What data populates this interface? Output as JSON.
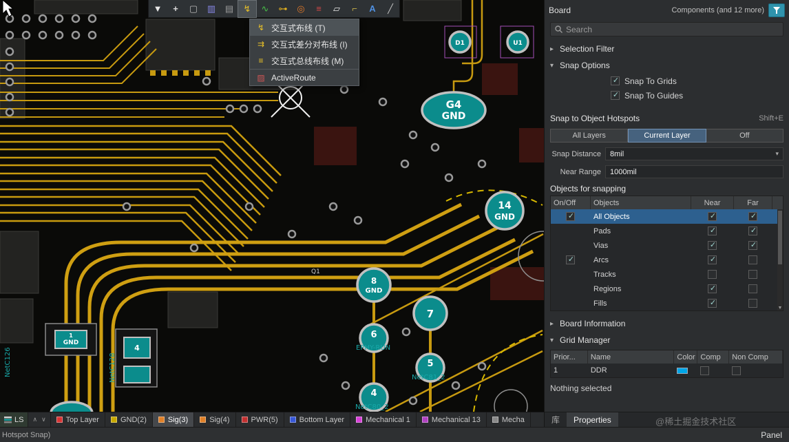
{
  "colors": {
    "selection_blue": "#2d608f",
    "pad_teal": "#0b8c8c",
    "trace_gold": "#c79a10",
    "filter_button_teal": "#2f93ac"
  },
  "toolbar": {
    "icons": [
      {
        "name": "filter-toolbar-icon",
        "glyph": "▼"
      },
      {
        "name": "move-icon",
        "glyph": "+"
      },
      {
        "name": "marquee-select-icon",
        "glyph": "▢"
      },
      {
        "name": "column-graph-icon",
        "glyph": "▥"
      },
      {
        "name": "row-graph-icon",
        "glyph": "▤"
      },
      {
        "name": "interactive-routing-icon",
        "glyph": "↯",
        "active": true
      },
      {
        "name": "signal-integrity-icon",
        "glyph": "∿"
      },
      {
        "name": "key-icon",
        "glyph": "⊶"
      },
      {
        "name": "via-stitch-icon",
        "glyph": "◎"
      },
      {
        "name": "layer-stack-icon",
        "glyph": "≡"
      },
      {
        "name": "polygon-pour-icon",
        "glyph": "▱"
      },
      {
        "name": "measure-icon",
        "glyph": "⌐"
      },
      {
        "name": "place-text-icon",
        "glyph": "A"
      },
      {
        "name": "place-line-icon",
        "glyph": "╱"
      }
    ]
  },
  "context_menu": {
    "items": [
      {
        "label": "交互式布线 (T)"
      },
      {
        "label": "交互式差分对布线 (I)"
      },
      {
        "label": "交互式总线布线 (M)"
      },
      {
        "label": "ActiveRoute"
      }
    ]
  },
  "pcb": {
    "pads": {
      "g4": {
        "l1": "G4",
        "l2": "GND"
      },
      "p14": {
        "l1": "14",
        "l2": "GND"
      },
      "p8": {
        "l1": "8",
        "l2": "GND"
      },
      "p7": {
        "l1": "7"
      },
      "p6": {
        "l1": "6"
      },
      "p5": {
        "l1": "5"
      },
      "p4": {
        "l1": "4"
      },
      "d1": {
        "l1": "D1"
      },
      "u1": {
        "l1": "U1"
      },
      "comp1": {
        "l1": "1",
        "l2": "GND"
      },
      "comp2": {
        "l1": "4"
      }
    },
    "nets": {
      "ephy": "EPHY-RUN",
      "netc81": "NetC81_2",
      "netc80": "NetC80_2",
      "netc126": "NetC126",
      "netc128": "NetC128",
      "q1": "Q1"
    }
  },
  "board_panel": {
    "title": "Board",
    "header_right": "Components (and 12 more)",
    "search": {
      "placeholder": "Search"
    },
    "selection_filter": {
      "label": "Selection Filter"
    },
    "snap_options": {
      "label": "Snap Options",
      "snap_to_grids": {
        "label": "Snap To Grids",
        "checked": true
      },
      "snap_to_guides": {
        "label": "Snap To Guides",
        "checked": true
      }
    },
    "snap_hotspots": {
      "label": "Snap to Object Hotspots",
      "shortcut": "Shift+E",
      "modes": [
        {
          "label": "All Layers",
          "active": false
        },
        {
          "label": "Current Layer",
          "active": true
        },
        {
          "label": "Off",
          "active": false
        }
      ],
      "snap_distance_label": "Snap Distance",
      "snap_distance_value": "8mil",
      "near_range_label": "Near Range",
      "near_range_value": "1000mil"
    },
    "objects_for_snapping": {
      "label": "Objects for snapping",
      "columns": [
        "On/Off",
        "Objects",
        "Near",
        "Far"
      ],
      "rows": [
        {
          "label": "All Objects",
          "onoff": true,
          "near": true,
          "far": true,
          "selected": true
        },
        {
          "label": "Pads",
          "near": true,
          "far": true
        },
        {
          "label": "Vias",
          "near": true,
          "far": true
        },
        {
          "label": "Arcs",
          "onoff": true,
          "near": true,
          "far": false
        },
        {
          "label": "Tracks",
          "near": false,
          "far": false
        },
        {
          "label": "Regions",
          "near": true,
          "far": false
        },
        {
          "label": "Fills",
          "near": true,
          "far": false
        }
      ]
    },
    "board_information": {
      "label": "Board Information"
    },
    "grid_manager": {
      "label": "Grid Manager",
      "columns": [
        "Prior...",
        "Name",
        "Color",
        "Comp",
        "Non Comp"
      ],
      "rows": [
        {
          "priority": "1",
          "name": "DDR",
          "color": "#00a6e8",
          "comp": false,
          "non_comp": false
        }
      ]
    },
    "nothing_selected": "Nothing selected",
    "tabs": [
      {
        "label": "库"
      },
      {
        "label": "Properties",
        "active": true
      }
    ]
  },
  "layer_bar": {
    "ls_label": "LS",
    "tabs": [
      {
        "label": "Top Layer",
        "color": "#d83434"
      },
      {
        "label": "GND(2)",
        "color": "#c8a800"
      },
      {
        "label": "Sig(3)",
        "color": "#e08028",
        "active": true
      },
      {
        "label": "Sig(4)",
        "color": "#e08028"
      },
      {
        "label": "PWR(5)",
        "color": "#c23030"
      },
      {
        "label": "Bottom Layer",
        "color": "#3858d8"
      },
      {
        "label": "Mechanical 1",
        "color": "#d840d8"
      },
      {
        "label": "Mechanical 13",
        "color": "#b040c0"
      },
      {
        "label": "Mecha",
        "color": "#888888"
      }
    ]
  },
  "status_bar": {
    "left": "Hotspot Snap)",
    "right": "Panel"
  },
  "watermark": "@稀土掘金技术社区"
}
